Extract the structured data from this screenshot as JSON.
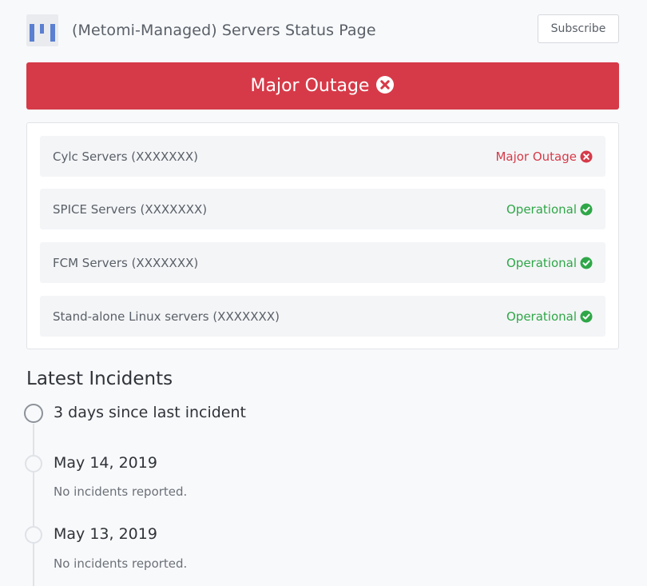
{
  "header": {
    "site_title": "(Metomi-Managed) Servers Status Page",
    "subscribe_label": "Subscribe",
    "logo_icon": "statuspage-logo-icon"
  },
  "banner": {
    "label": "Major Outage",
    "icon": "x-circle-icon",
    "color": "#d63a48"
  },
  "components": [
    {
      "name": "Cylc Servers (XXXXXXX)",
      "status": "Major Outage",
      "state": "down",
      "icon": "x-circle-icon"
    },
    {
      "name": "SPICE Servers (XXXXXXX)",
      "status": "Operational",
      "state": "ok",
      "icon": "check-circle-icon"
    },
    {
      "name": "FCM Servers (XXXXXXX)",
      "status": "Operational",
      "state": "ok",
      "icon": "check-circle-icon"
    },
    {
      "name": "Stand-alone Linux servers (XXXXXXX)",
      "status": "Operational",
      "state": "ok",
      "icon": "check-circle-icon"
    }
  ],
  "colors": {
    "outage": "#d63a48",
    "operational": "#2fa748"
  },
  "incidents": {
    "title": "Latest Incidents",
    "since_last": "3 days since last incident",
    "days": [
      {
        "date": "May 14, 2019",
        "text": "No incidents reported."
      },
      {
        "date": "May 13, 2019",
        "text": "No incidents reported."
      }
    ]
  }
}
